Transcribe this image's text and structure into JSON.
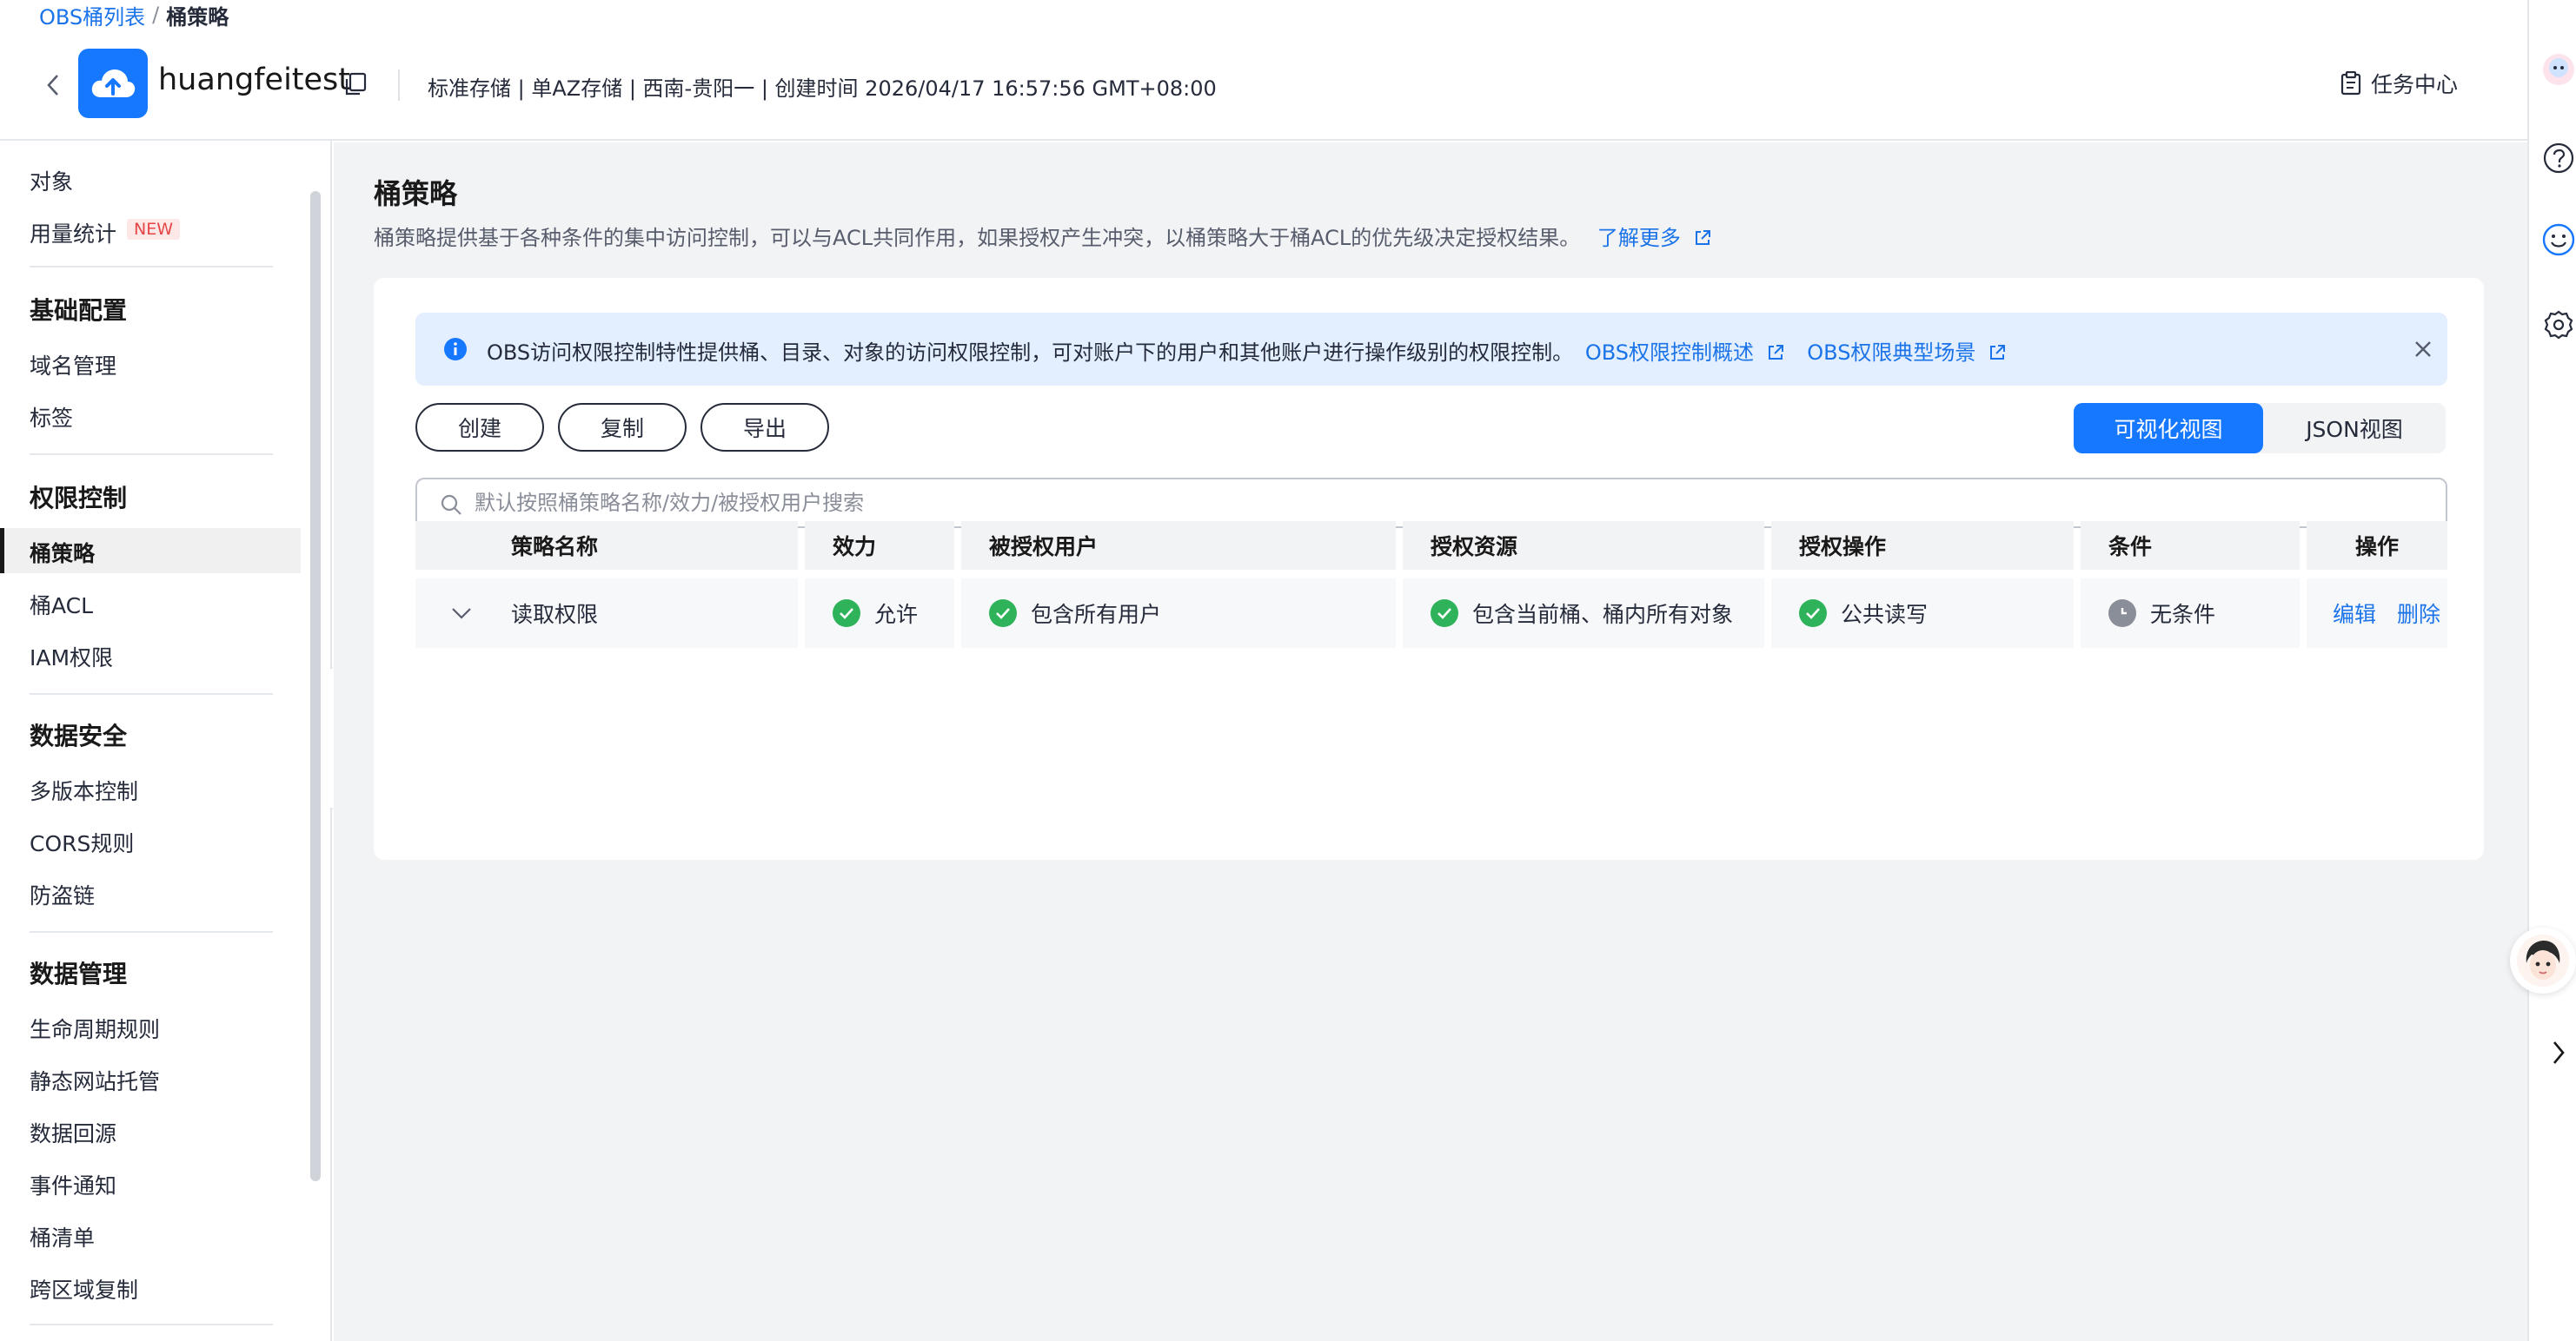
{
  "breadcrumb": {
    "parent": "OBS桶列表",
    "separator": "/",
    "current": "桶策略"
  },
  "bucket": {
    "name": "huangfeitest",
    "meta": "标准存储 | 单AZ存储 | 西南-贵阳一 | 创建时间  2026/04/17 16:57:56 GMT+08:00"
  },
  "header": {
    "task_center": "任务中心"
  },
  "sidebar": {
    "objects": "对象",
    "usage": "用量统计",
    "usage_badge": "NEW",
    "groups": {
      "basic": {
        "title": "基础配置",
        "items": [
          "域名管理",
          "标签"
        ]
      },
      "permission": {
        "title": "权限控制",
        "items": [
          "桶策略",
          "桶ACL",
          "IAM权限"
        ]
      },
      "security": {
        "title": "数据安全",
        "items": [
          "多版本控制",
          "CORS规则",
          "防盗链"
        ]
      },
      "management": {
        "title": "数据管理",
        "items": [
          "生命周期规则",
          "静态网站托管",
          "数据回源",
          "事件通知",
          "桶清单",
          "跨区域复制"
        ]
      }
    }
  },
  "page": {
    "title": "桶策略",
    "description": "桶策略提供基于各种条件的集中访问控制，可以与ACL共同作用，如果授权产生冲突，以桶策略大于桶ACL的优先级决定授权结果。",
    "learn_more": "了解更多"
  },
  "info": {
    "text": "OBS访问权限控制特性提供桶、目录、对象的访问权限控制，可对账户下的用户和其他账户进行操作级别的权限控制。",
    "link1": "OBS权限控制概述",
    "link2": "OBS权限典型场景"
  },
  "toolbar": {
    "create": "创建",
    "copy": "复制",
    "export": "导出",
    "view_visual": "可视化视图",
    "view_json": "JSON视图"
  },
  "search": {
    "placeholder": "默认按照桶策略名称/效力/被授权用户搜索"
  },
  "table": {
    "columns": [
      "策略名称",
      "效力",
      "被授权用户",
      "授权资源",
      "授权操作",
      "条件",
      "操作"
    ],
    "rows": [
      {
        "name": "读取权限",
        "effect": "允许",
        "principal": "包含所有用户",
        "resource": "包含当前桶、桶内所有对象",
        "action": "公共读写",
        "condition": "无条件",
        "ops": [
          "编辑",
          "删除"
        ]
      }
    ]
  },
  "colors": {
    "accent": "#1677ff",
    "success": "#2fb35a",
    "link": "#1a73e8",
    "badge": "#e64545"
  }
}
